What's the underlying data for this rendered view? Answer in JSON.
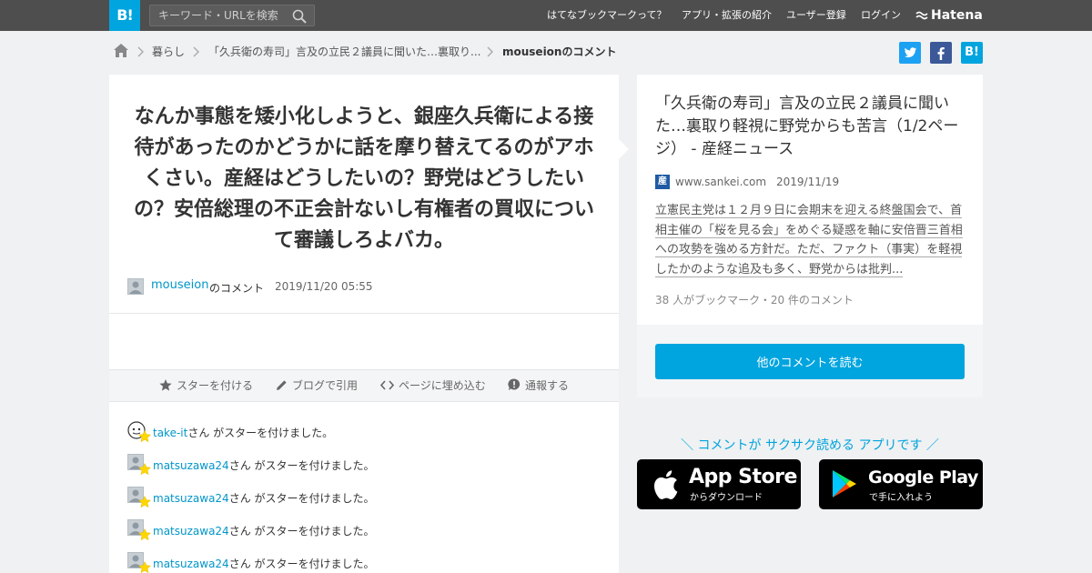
{
  "header": {
    "logo_text": "B!",
    "search_placeholder": "キーワード・URLを検索",
    "nav": [
      "はてなブックマークって？",
      "アプリ・拡張の紹介",
      "ユーザー登録",
      "ログイン"
    ],
    "brand": "Hatena"
  },
  "breadcrumb": {
    "category": "暮らし",
    "entry": "「久兵衛の寿司」言及の立民２議員に聞いた…裏取り...",
    "current": "mouseionのコメント"
  },
  "share": {
    "twitter": "t",
    "facebook": "f",
    "hatena": "B!"
  },
  "comment": {
    "body": "なんか事態を矮小化しようと、銀座久兵衛による接待があったのかどうかに話を摩り替えてるのがアホくさい。産経はどうしたいの？野党はどうしたいの？安倍総理の不正会計ないし有権者の買収について審議しろよバカ。",
    "user": "mouseion",
    "user_suffix": "のコメント",
    "date": "2019/11/20 05:55"
  },
  "actions": [
    "スターを付ける",
    "ブログで引用",
    "ページに埋め込む",
    "通報する"
  ],
  "stars": [
    {
      "user": "take-it",
      "text": "さん がスターを付けました。"
    },
    {
      "user": "matsuzawa24",
      "text": "さん がスターを付けました。"
    },
    {
      "user": "matsuzawa24",
      "text": "さん がスターを付けました。"
    },
    {
      "user": "matsuzawa24",
      "text": "さん がスターを付けました。"
    },
    {
      "user": "matsuzawa24",
      "text": "さん がスターを付けました。"
    }
  ],
  "entry": {
    "title": "「久兵衛の寿司」言及の立民２議員に聞いた…裏取り軽視に野党からも苦言（1/2ページ） - 産経ニュース",
    "site_icon": "産",
    "domain": "www.sankei.com",
    "date": "2019/11/19",
    "summary": "立憲民主党は１２月９日に会期末を迎える終盤国会で、首相主催の「桜を見る会」をめぐる疑惑を軸に安倍晋三首相への攻勢を強める方針だ。ただ、ファクト（事実）を軽視したかのような追及も多く、野党からは批判...",
    "counts": "38 人がブックマーク・20 件のコメント",
    "more_button": "他のコメントを読む"
  },
  "promo": {
    "tagline": "＼ コメントが サクサク読める アプリです ／",
    "appstore_big": "App Store",
    "appstore_small": "からダウンロード",
    "googleplay_big": "Google Play",
    "googleplay_small": "で手に入れよう"
  },
  "colors": {
    "accent": "#00a4de",
    "topbar": "#4e4e4e",
    "link": "#0096c8",
    "twitter": "#1da1f2",
    "facebook": "#3b5998"
  }
}
